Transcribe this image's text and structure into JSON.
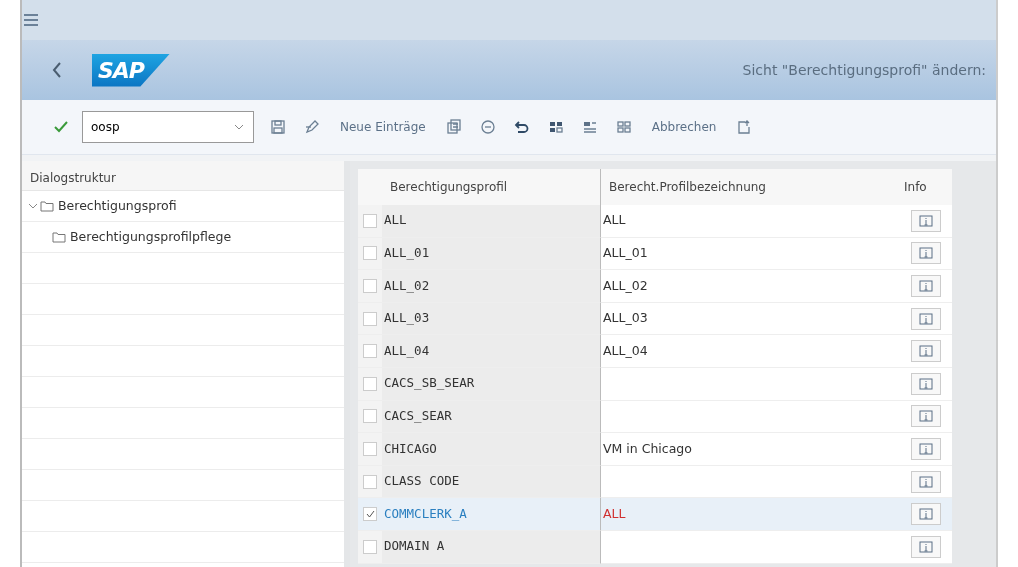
{
  "shell": {
    "title": "Sicht \"Berechtigungsprofi\" ändern:",
    "logo": "SAP"
  },
  "toolbar": {
    "command_field": {
      "value": "oosp"
    },
    "items": [
      {
        "kind": "icon"
      },
      {
        "kind": "icon"
      },
      {
        "kind": "text",
        "label": "Neue Einträge"
      },
      {
        "kind": "icon"
      },
      {
        "kind": "icon"
      },
      {
        "kind": "icon"
      },
      {
        "kind": "icon"
      },
      {
        "kind": "icon"
      },
      {
        "kind": "icon"
      },
      {
        "kind": "text",
        "label": "Abbrechen"
      },
      {
        "kind": "icon"
      }
    ]
  },
  "dialog_structure": {
    "title": "Dialogstruktur",
    "tree": [
      {
        "label": "Berechtigungsprofi",
        "expanded": true,
        "children": [
          {
            "label": "Berechtigungsprofilpflege"
          }
        ]
      }
    ]
  },
  "table": {
    "columns": [
      "Berechtigungsprofil",
      "Berecht.Profilbezeichnung",
      "Info"
    ],
    "rows": [
      {
        "profile": "ALL",
        "name": "ALL",
        "selected": false
      },
      {
        "profile": "ALL_01",
        "name": "ALL_01",
        "selected": false
      },
      {
        "profile": "ALL_02",
        "name": "ALL_02",
        "selected": false
      },
      {
        "profile": "ALL_03",
        "name": "ALL_03",
        "selected": false
      },
      {
        "profile": "ALL_04",
        "name": "ALL_04",
        "selected": false
      },
      {
        "profile": "CACS_SB_SEAR",
        "selected": false
      },
      {
        "profile": "CACS_SEAR",
        "selected": false
      },
      {
        "profile": "CHICAGO",
        "name": "VM in Chicago",
        "selected": false
      },
      {
        "profile": "CLASS CODE",
        "selected": false
      },
      {
        "profile": "COMMCLERK_A",
        "name": "ALL",
        "selected": true
      },
      {
        "profile": "DOMAIN A",
        "selected": false
      }
    ]
  }
}
